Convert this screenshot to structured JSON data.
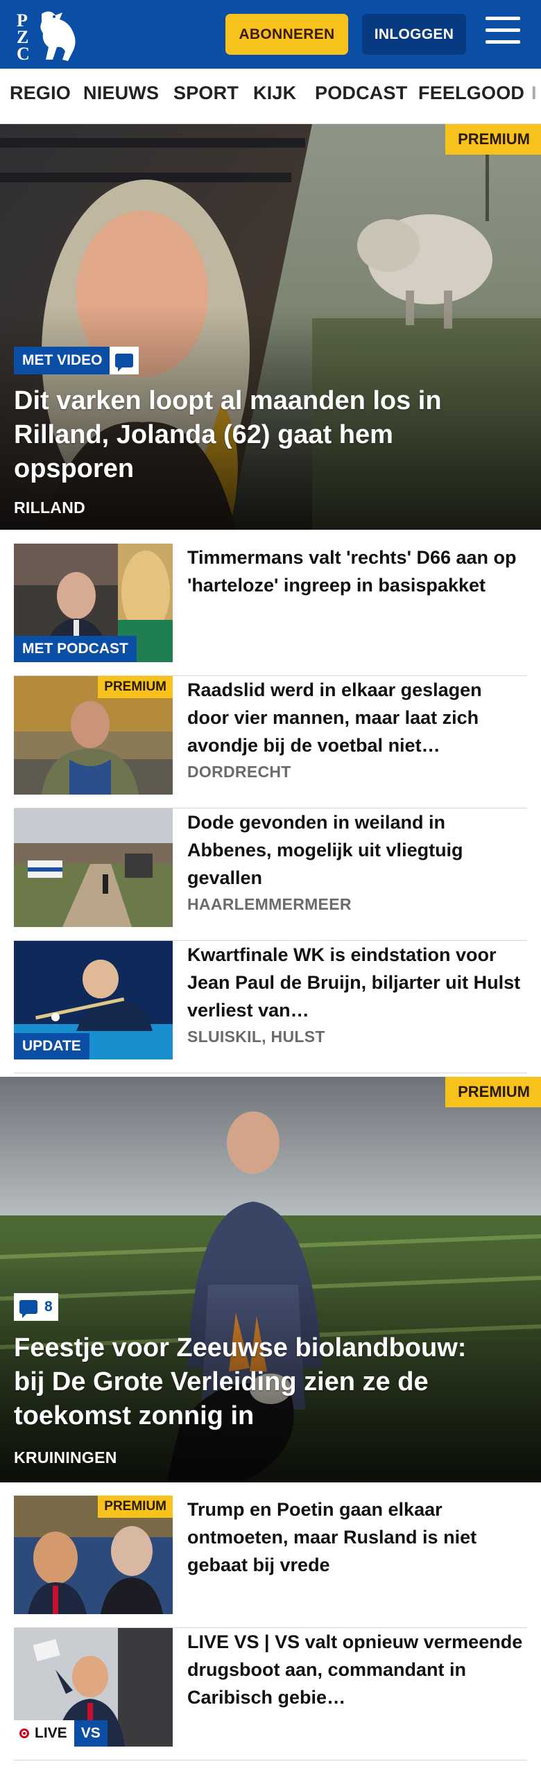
{
  "header": {
    "logo_text": "PZC",
    "subscribe_label": "ABONNEREN",
    "login_label": "INLOGGEN",
    "menu_icon": "hamburger-menu-icon",
    "brand_color": "#0a4ea5",
    "accent_color": "#f7c21b"
  },
  "nav": {
    "items": [
      "REGIO",
      "NIEUWS",
      "SPORT",
      "KIJK",
      "PODCAST",
      "FEELGOOD",
      "I"
    ]
  },
  "hero1": {
    "premium": "PREMIUM",
    "badge": "MET VIDEO",
    "badge_icon": "comment-bubble-icon",
    "title": "Dit varken loopt al maanden los in Rilland, Jolanda (62) gaat hem opsporen",
    "location": "RILLAND"
  },
  "articles1": [
    {
      "title": "Timmermans valt 'rechts' D66 aan op 'harteloze' ingreep in basispakket",
      "location": "",
      "tag": "MET PODCAST",
      "premium": ""
    },
    {
      "title": "Raadslid werd in elkaar geslagen door vier mannen, maar laat zich avondje bij de voetbal niet…",
      "location": "DORDRECHT",
      "tag": "",
      "premium": "PREMIUM"
    },
    {
      "title": "Dode gevonden in weiland in Abbenes, mogelijk uit vliegtuig gevallen",
      "location": "HAARLEMMERMEER",
      "tag": "",
      "premium": ""
    },
    {
      "title": "Kwartfinale WK is eindstation voor Jean Paul de Bruijn, biljarter uit Hulst verliest van…",
      "location": "SLUISKIL, HULST",
      "tag": "UPDATE",
      "premium": ""
    }
  ],
  "hero2": {
    "premium": "PREMIUM",
    "comment_count": "8",
    "badge_icon": "comment-bubble-icon",
    "title": "Feestje voor Zeeuwse biolandbouw: bij De Grote Verleiding zien ze de toekomst zonnig in",
    "location": "KRUININGEN"
  },
  "articles2": [
    {
      "title": "Trump en Poetin gaan elkaar ontmoeten, maar Rusland is niet gebaat bij vrede",
      "location": "",
      "premium": "PREMIUM"
    },
    {
      "title": "LIVE VS | VS valt opnieuw vermeende drugsboot aan, commandant in Caribisch gebie…",
      "location": "",
      "live": "LIVE",
      "vs": "VS"
    }
  ]
}
